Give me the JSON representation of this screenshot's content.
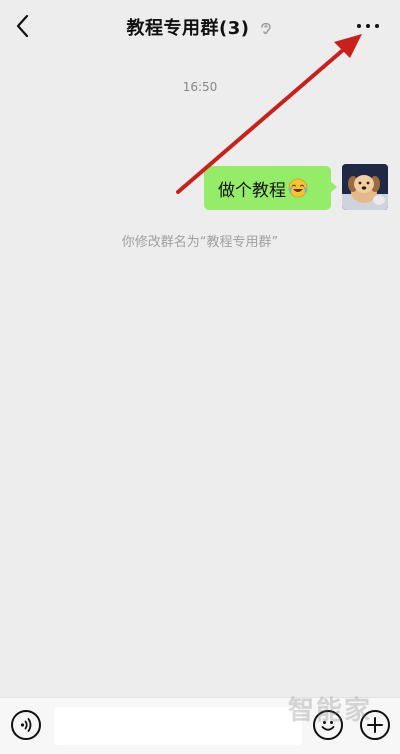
{
  "header": {
    "title": "教程专用群(3)",
    "back_icon": "chevron-left-icon",
    "muted_icon": "ear-icon",
    "more_icon": "more-dots-icon"
  },
  "chat": {
    "timestamp": "16:50",
    "messages": [
      {
        "sender": "self",
        "text": "做个教程",
        "emoji": "laughing-crying-emoji"
      }
    ],
    "system_note": "你修改群名为“教程专用群”"
  },
  "input_bar": {
    "placeholder": "",
    "voice_icon": "voice-icon",
    "emoji_icon": "smiley-icon",
    "plus_icon": "plus-circle-icon"
  },
  "watermark": "智能家",
  "colors": {
    "background": "#ededed",
    "bubble": "#95ec69",
    "arrow": "#c8211c"
  }
}
